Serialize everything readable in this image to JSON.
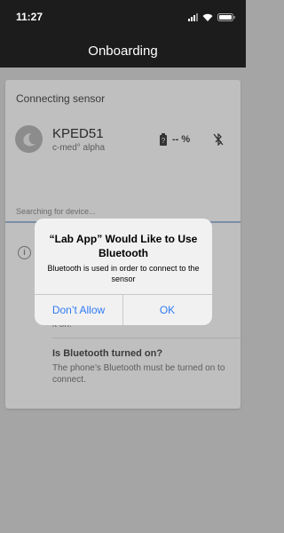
{
  "status_bar": {
    "time": "11:27"
  },
  "nav": {
    "title": "Onboarding"
  },
  "card": {
    "title": "Connecting sensor",
    "device": {
      "name": "KPED51",
      "model": "c-med° alpha",
      "battery_label": "-- %"
    },
    "searching_text": "Searching for device...",
    "tip_partial": "it on.",
    "tip": {
      "title": "Is Bluetooth turned on?",
      "description": "The phone’s Bluetooth must be turned on to connect."
    }
  },
  "alert": {
    "title": "“Lab App” Would Like to Use Bluetooth",
    "message": "Bluetooth is used in order to connect to the sensor",
    "buttons": {
      "deny": "Don’t Allow",
      "ok": "OK"
    }
  },
  "colors": {
    "accent": "#2f7bf5",
    "header": "#1c1c1c"
  },
  "icons": [
    "signal-icon",
    "wifi-icon",
    "battery-icon",
    "device-battery-icon",
    "bluetooth-disabled-icon",
    "info-icon"
  ]
}
